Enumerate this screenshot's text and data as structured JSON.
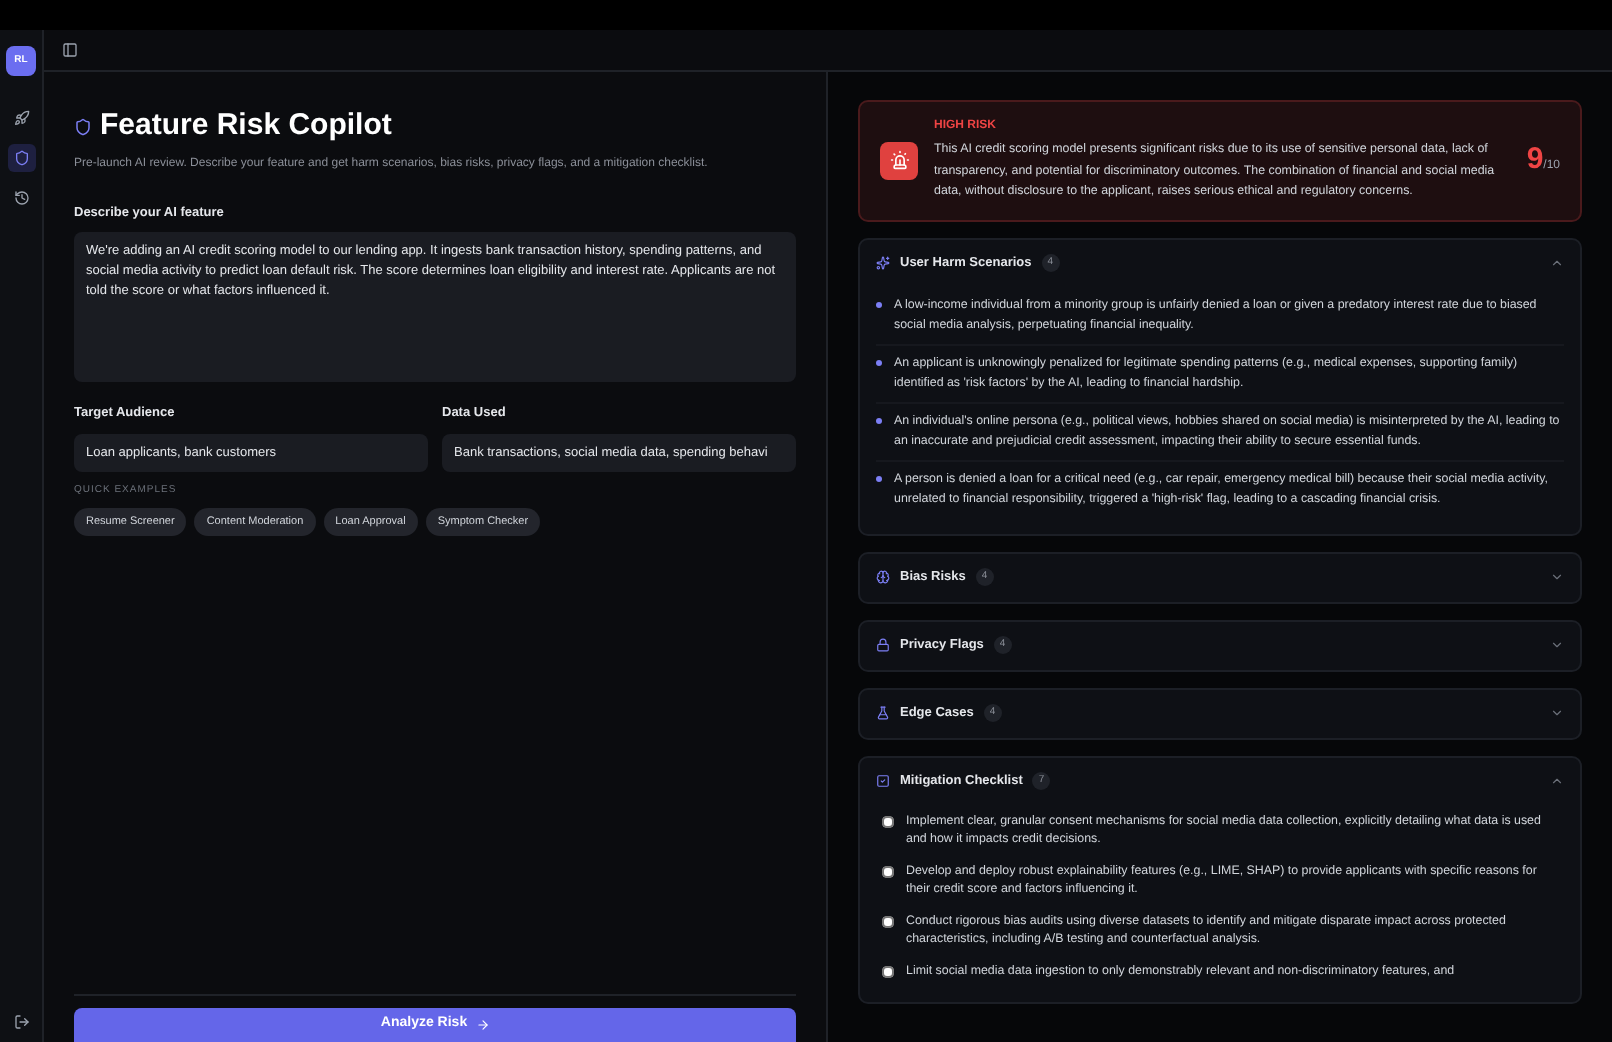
{
  "user": {
    "initials": "RL"
  },
  "sidebar": {
    "items": [
      {
        "kind": "rocket",
        "selected": false
      },
      {
        "kind": "shield",
        "selected": true
      },
      {
        "kind": "history",
        "selected": false
      }
    ]
  },
  "title": "Feature Risk Copilot",
  "subtitle": "Pre-launch AI review. Describe your feature and get harm scenarios, bias risks, privacy flags, and a mitigation checklist.",
  "description": {
    "label": "Describe your AI feature",
    "value": "We're adding an AI credit scoring model to our lending app. It ingests bank transaction history, spending patterns, and social media activity to predict loan default risk. The score determines loan eligibility and interest rate. Applicants are not told the score or what factors influenced it."
  },
  "audience": {
    "label": "Target Audience",
    "value": "Loan applicants, bank customers"
  },
  "data_used": {
    "label": "Data Used",
    "value": "Bank transactions, social media data, spending behavi"
  },
  "quick_examples": {
    "label": "QUICK EXAMPLES",
    "items": [
      "Resume Screener",
      "Content Moderation",
      "Loan Approval",
      "Symptom Checker"
    ]
  },
  "analyze_button": "Analyze Risk",
  "risk": {
    "level": "HIGH RISK",
    "summary": "This AI credit scoring model presents significant risks due to its use of sensitive personal data, lack of transparency, and potential for discriminatory outcomes. The combination of financial and social media data, without disclosure to the applicant, raises serious ethical and regulatory concerns.",
    "score": "9",
    "out_of": "/10"
  },
  "sections": [
    {
      "kind": "harm",
      "title": "User Harm Scenarios",
      "count": "4",
      "expanded": true,
      "items": [
        "A low-income individual from a minority group is unfairly denied a loan or given a predatory interest rate due to biased social media analysis, perpetuating financial inequality.",
        "An applicant is unknowingly penalized for legitimate spending patterns (e.g., medical expenses, supporting family) identified as 'risk factors' by the AI, leading to financial hardship.",
        "An individual's online persona (e.g., political views, hobbies shared on social media) is misinterpreted by the AI, leading to an inaccurate and prejudicial credit assessment, impacting their ability to secure essential funds.",
        "A person is denied a loan for a critical need (e.g., car repair, emergency medical bill) because their social media activity, unrelated to financial responsibility, triggered a 'high-risk' flag, leading to a cascading financial crisis."
      ]
    },
    {
      "kind": "bias",
      "title": "Bias Risks",
      "count": "4",
      "expanded": false
    },
    {
      "kind": "privacy",
      "title": "Privacy Flags",
      "count": "4",
      "expanded": false
    },
    {
      "kind": "edge",
      "title": "Edge Cases",
      "count": "4",
      "expanded": false
    },
    {
      "kind": "checklist",
      "title": "Mitigation Checklist",
      "count": "7",
      "expanded": true,
      "items": [
        {
          "text": "Implement clear, granular consent mechanisms for social media data collection, explicitly detailing what data is used and how it impacts credit decisions.",
          "checked": false
        },
        {
          "text": "Develop and deploy robust explainability features (e.g., LIME, SHAP) to provide applicants with specific reasons for their credit score and factors influencing it.",
          "checked": false
        },
        {
          "text": "Conduct rigorous bias audits using diverse datasets to identify and mitigate disparate impact across protected characteristics, including A/B testing and counterfactual analysis.",
          "checked": false
        },
        {
          "text": "Limit social media data ingestion to only demonstrably relevant and non-discriminatory features, and",
          "checked": false
        }
      ]
    }
  ]
}
